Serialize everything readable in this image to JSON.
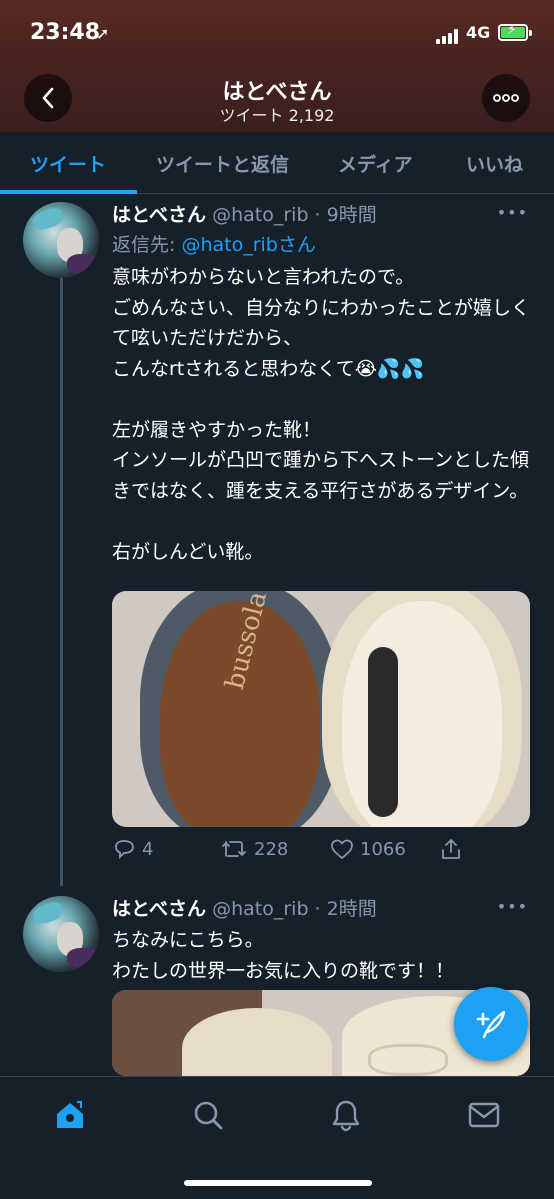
{
  "status_bar": {
    "time": "23:48",
    "network": "4G",
    "location_icon": "location-arrow-icon"
  },
  "profile": {
    "name": "はとべさん",
    "tweet_count_label": "ツイート 2,192"
  },
  "tabs": [
    {
      "label": "ツイート",
      "active": true
    },
    {
      "label": "ツイートと返信",
      "active": false
    },
    {
      "label": "メディア",
      "active": false
    },
    {
      "label": "いいね",
      "active": false
    }
  ],
  "tweets": [
    {
      "name": "はとべさん",
      "handle_time": "@hato_rib · 9時間",
      "reply_prefix": "返信先: ",
      "reply_handle": "@hato_ribさん",
      "text": "意味がわからないと言われたので。\nごめんなさい、自分なりにわかったことが嬉しくて呟いただけだから、\nこんなrtされると思わなくて😭💦💦\n\n左が履きやすかった靴！\nインソールが凸凹で踵から下へストーンとした傾きではなく、踵を支える平行さがあるデザイン。\n\n右がしんどい靴。",
      "image_brand_text": "bussola",
      "replies": "4",
      "retweets": "228",
      "likes": "1066"
    },
    {
      "name": "はとべさん",
      "handle_time": "@hato_rib · 2時間",
      "text": "ちなみにこちら。\nわたしの世界一お気に入りの靴です！！"
    }
  ],
  "colors": {
    "accent": "#1da1f2",
    "background": "#15202b",
    "muted": "#8899a6"
  },
  "nav": [
    "home-icon",
    "search-icon",
    "notifications-icon",
    "messages-icon"
  ],
  "fab_icon": "compose-tweet-icon"
}
